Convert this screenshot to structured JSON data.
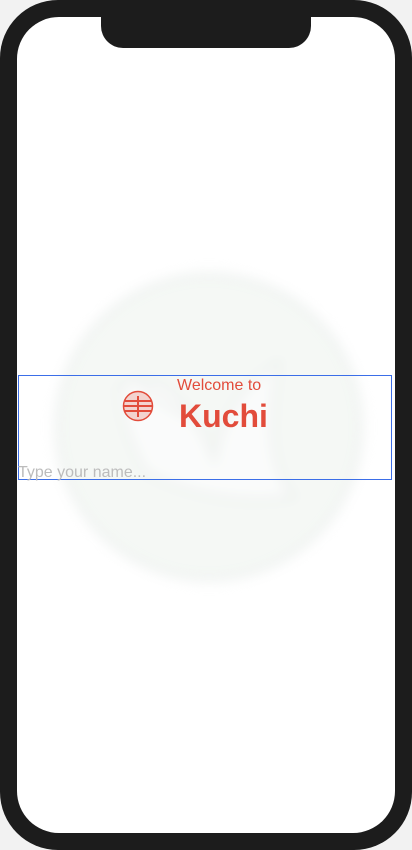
{
  "welcome": {
    "subtitle": "Welcome to",
    "title": "Kuchi",
    "accent_color": "#e24c3b"
  },
  "name_field": {
    "placeholder": "Type your name...",
    "value": ""
  },
  "icons": {
    "welcome_icon": "kuchi-mark-icon",
    "background_logo": "kuchi-bird-logo"
  }
}
